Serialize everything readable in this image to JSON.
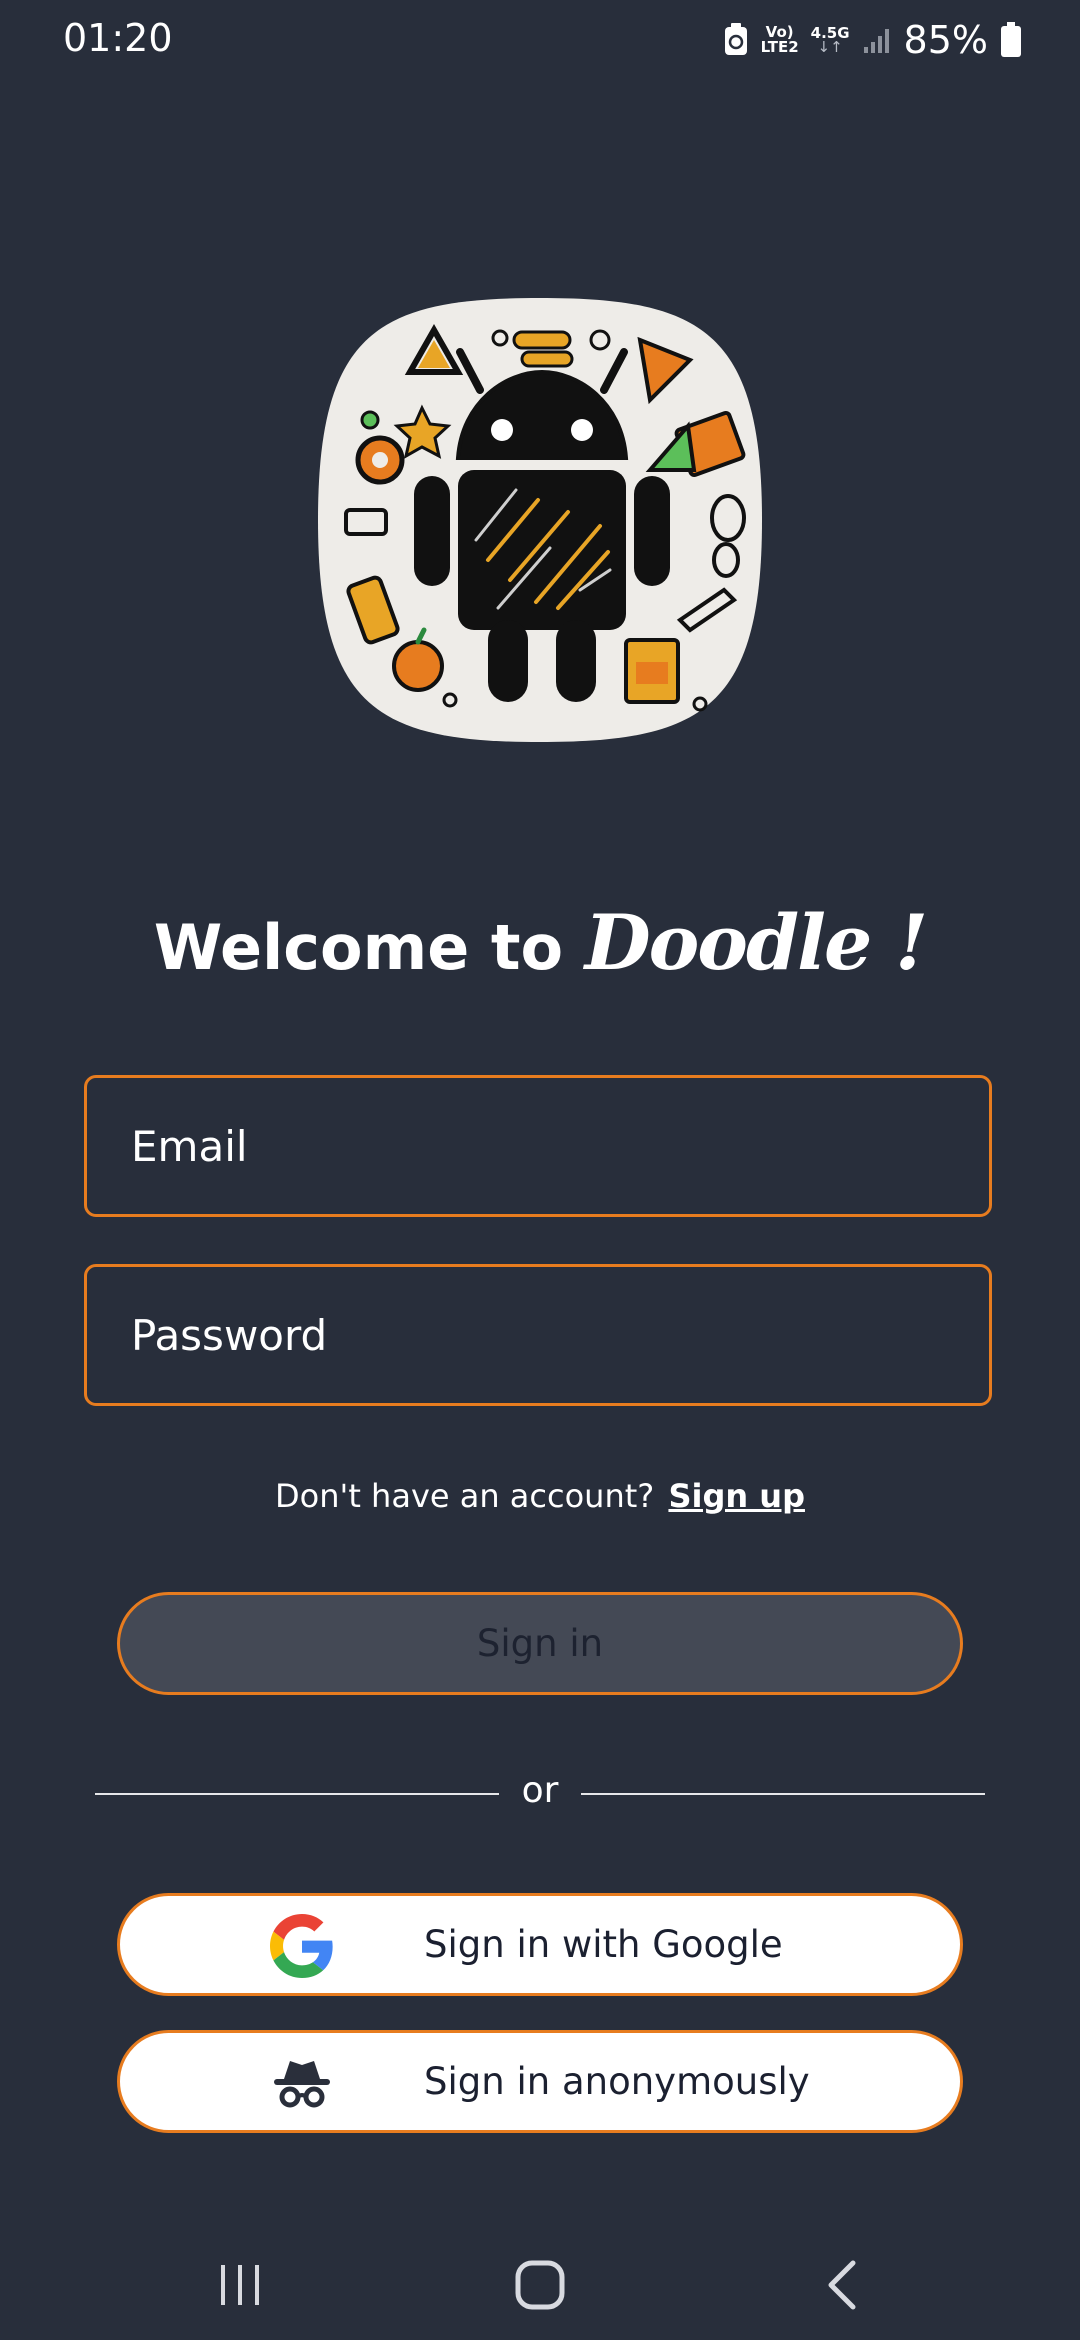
{
  "status_bar": {
    "time": "01:20",
    "network_top": "Vo)",
    "network_bottom": "LTE2",
    "network_type": "4.5G",
    "battery": "85%",
    "icons": [
      "data-saver-icon",
      "volte-icon",
      "data-arrows-icon",
      "signal-icon",
      "battery-icon"
    ]
  },
  "logo": {
    "icon": "android-doodle-logo"
  },
  "title": {
    "prefix": "Welcome to",
    "brand": "Doodle !"
  },
  "form": {
    "email_placeholder": "Email",
    "password_placeholder": "Password"
  },
  "signup": {
    "prompt": "Don't have an account?",
    "link": "Sign up"
  },
  "buttons": {
    "sign_in": "Sign in",
    "or": "or",
    "google": "Sign in with Google",
    "anonymous": "Sign in anonymously"
  },
  "nav": {
    "icons": [
      "recents-icon",
      "home-icon",
      "back-icon"
    ]
  },
  "colors": {
    "background": "#282e3b",
    "accent": "#e77c1f",
    "button_disabled": "#444955",
    "text": "#ffffff"
  }
}
